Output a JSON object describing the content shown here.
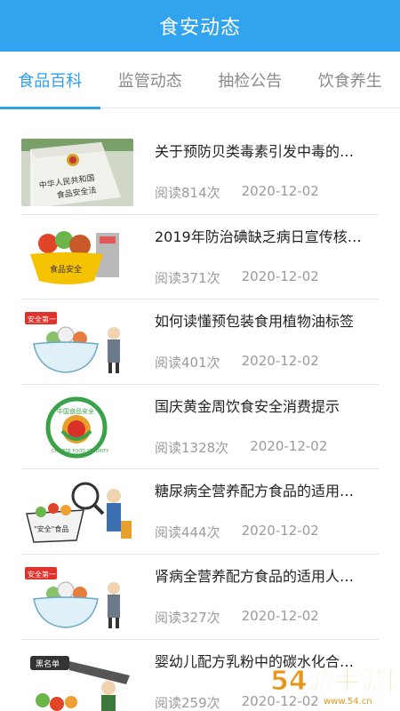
{
  "header": {
    "title": "食安动态"
  },
  "tabs": [
    {
      "label": "食品百科",
      "active": true
    },
    {
      "label": "监管动态",
      "active": false
    },
    {
      "label": "抽检公告",
      "active": false
    },
    {
      "label": "饮食养生",
      "active": false
    }
  ],
  "articles": [
    {
      "title": "关于预防贝类毒素引发中毒的…",
      "reads": "阅读814次",
      "date": "2020-12-02",
      "thumb": "law-book"
    },
    {
      "title": "2019年防治碘缺乏病日宣传核…",
      "reads": "阅读371次",
      "date": "2020-12-02",
      "thumb": "food-safety-basket"
    },
    {
      "title": "如何读懂预包装食用植物油标签",
      "reads": "阅读401次",
      "date": "2020-12-02",
      "thumb": "safety-first-bowl"
    },
    {
      "title": "国庆黄金周饮食安全消费提示",
      "reads": "阅读1328次",
      "date": "2020-12-02",
      "thumb": "food-safety-logo"
    },
    {
      "title": "糖尿病全营养配方食品的适用…",
      "reads": "阅读444次",
      "date": "2020-12-02",
      "thumb": "magnifier-inspector"
    },
    {
      "title": "肾病全营养配方食品的适用人…",
      "reads": "阅读327次",
      "date": "2020-12-02",
      "thumb": "safety-first-bowl"
    },
    {
      "title": "婴幼儿配方乳粉中的碳水化合…",
      "reads": "阅读259次",
      "date": "2020-12-02",
      "thumb": "blacklist-chainsaw"
    }
  ],
  "thumb_text": {
    "law_line1": "中华人民共和国",
    "law_line2": "食品安全法",
    "basket": "食品安全",
    "safety_first": "安全第一",
    "logo_top": "中国食品安全",
    "logo_bottom": "CHINESE FOOD SECURITY",
    "quoted_food": "\"安全\"食品",
    "blacklist": "黑名单"
  },
  "watermark": {
    "text": "54游手游网",
    "url": "www.54.cn"
  },
  "colors": {
    "header_bg": "#32a3ef",
    "tab_active": "#2f9fe8",
    "tab_inactive": "#8a8a8a"
  }
}
